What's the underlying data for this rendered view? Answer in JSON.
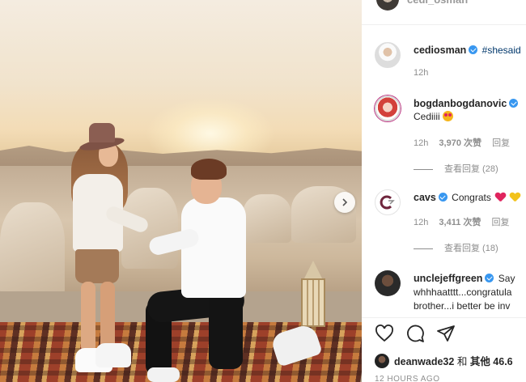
{
  "post": {
    "author_top": "cedi_osman"
  },
  "comments": [
    {
      "avatar": "cedi-avatar",
      "username": "cediosman",
      "verified": true,
      "text": "#shesaid",
      "time": "12h",
      "likes": "",
      "reply_label": "",
      "view_replies": ""
    },
    {
      "avatar": "bogdan-avatar",
      "username": "bogdanbogdanovic",
      "verified": true,
      "text": "Cediiii",
      "emoji": "heart-eyes-emoji",
      "time": "12h",
      "likes": "3,970 次赞",
      "reply_label": "回复",
      "view_replies": "查看回复 (28)"
    },
    {
      "avatar": "cavs-avatar",
      "username": "cavs",
      "verified": true,
      "text": "Congrats",
      "emoji": "red-heart, yellow-heart",
      "time": "12h",
      "likes": "3,411 次赞",
      "reply_label": "回复",
      "view_replies": "查看回复 (18)"
    },
    {
      "avatar": "jeff-avatar",
      "username": "unclejeffgreen",
      "verified": true,
      "text_line1": "Say",
      "text_line2": "whhhaatttt...congratula",
      "text_line3": "brother...i better be inv"
    }
  ],
  "actions": {
    "icons": [
      "heart-icon",
      "comment-icon",
      "share-icon"
    ]
  },
  "liked_by": {
    "user": "deanwade32",
    "joiner": "和",
    "others": "其他 46.6"
  },
  "timestamp": "12 HOURS AGO",
  "colors": {
    "verified": "#3897f0",
    "link": "#00376b",
    "meta": "#8e8e8e"
  }
}
